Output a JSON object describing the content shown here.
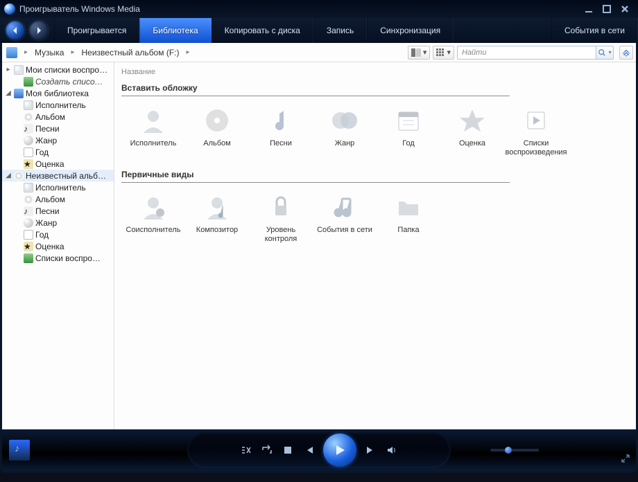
{
  "title": "Проигрыватель Windows Media",
  "tabs": {
    "now_playing": "Проигрывается",
    "library": "Библиотека",
    "rip": "Копировать с диска",
    "burn": "Запись",
    "sync": "Синхронизация",
    "online": "События в сети"
  },
  "breadcrumb": {
    "root": "Музыка",
    "node": "Неизвестный альбом (F:)"
  },
  "search": {
    "placeholder": "Найти"
  },
  "column_header": "Название",
  "tree": {
    "playlists": "Мои списки воспро…",
    "create_playlist": "Создать списо…",
    "library": "Моя библиотека",
    "artist": "Исполнитель",
    "album": "Альбом",
    "songs": "Песни",
    "genre": "Жанр",
    "year": "Год",
    "rating": "Оценка",
    "unknown_album": "Неизвестный альб…",
    "playlists2": "Списки воспро…"
  },
  "sections": {
    "stack": "Вставить обложку",
    "primary": "Первичные виды"
  },
  "grid1": {
    "artist": "Исполнитель",
    "album": "Альбом",
    "songs": "Песни",
    "genre": "Жанр",
    "year": "Год",
    "rating": "Оценка",
    "playlists": "Списки воспроизведения"
  },
  "grid2": {
    "contrib": "Соисполнитель",
    "composer": "Композитор",
    "parental": "Уровень контроля",
    "online": "События в сети",
    "folder": "Папка"
  }
}
